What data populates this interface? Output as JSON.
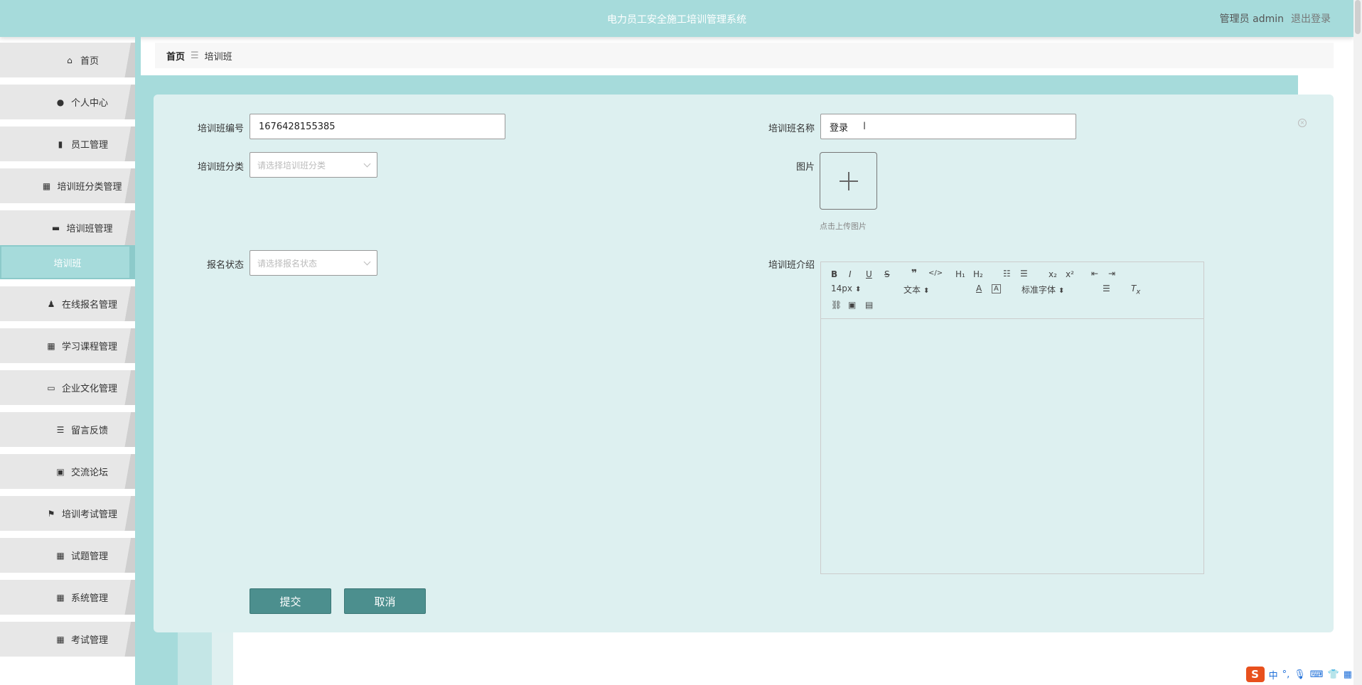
{
  "header": {
    "title": "电力员工安全施工培训管理系统",
    "user_label": "管理员 admin",
    "logout_label": "退出登录"
  },
  "sidebar": {
    "items": [
      {
        "label": "首页",
        "icon": "home-icon"
      },
      {
        "label": "个人中心",
        "icon": "user-icon"
      },
      {
        "label": "员工管理",
        "icon": "bar-chart-icon"
      },
      {
        "label": "培训班分类管理",
        "icon": "grid-icon"
      },
      {
        "label": "培训班管理",
        "icon": "comment-icon"
      },
      {
        "label": "培训班",
        "icon": ""
      },
      {
        "label": "在线报名管理",
        "icon": "person-icon"
      },
      {
        "label": "学习课程管理",
        "icon": "grid-icon"
      },
      {
        "label": "企业文化管理",
        "icon": "monitor-icon"
      },
      {
        "label": "留言反馈",
        "icon": "list-icon"
      },
      {
        "label": "交流论坛",
        "icon": "clipboard-icon"
      },
      {
        "label": "培训考试管理",
        "icon": "flag-icon"
      },
      {
        "label": "试题管理",
        "icon": "grid-icon"
      },
      {
        "label": "系统管理",
        "icon": "grid-icon"
      },
      {
        "label": "考试管理",
        "icon": "grid-icon"
      }
    ]
  },
  "breadcrumb": {
    "home": "首页",
    "separator": "☰",
    "current": "培训班"
  },
  "form": {
    "code_label": "培训班编号",
    "code_value": "1676428155385",
    "name_label": "培训班名称",
    "name_value": "登录",
    "category_label": "培训班分类",
    "category_placeholder": "请选择培训班分类",
    "image_label": "图片",
    "upload_hint": "点击上传图片",
    "status_label": "报名状态",
    "status_placeholder": "请选择报名状态",
    "intro_label": "培训班介绍",
    "editor": {
      "font_size": "14px",
      "block_type": "文本",
      "font_family": "标准字体"
    },
    "submit_label": "提交",
    "cancel_label": "取消"
  },
  "ime": {
    "lang": "中",
    "punct": "°,"
  },
  "colors": {
    "accent": "#a6dbdb",
    "panel": "#ddf0f0",
    "button": "#4c8f8e"
  }
}
